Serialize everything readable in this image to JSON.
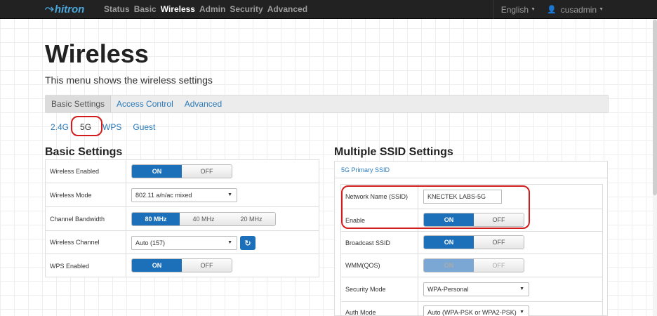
{
  "navbar": {
    "brand": "hitron",
    "links": [
      "Status",
      "Basic",
      "Wireless",
      "Admin",
      "Security",
      "Advanced"
    ],
    "active_link": "Wireless",
    "language": "English",
    "user": "cusadmin"
  },
  "page": {
    "title": "Wireless",
    "description": "This menu shows the wireless settings"
  },
  "tabs": [
    "Basic Settings",
    "Access Control",
    "Advanced"
  ],
  "active_tab": "Basic Settings",
  "subtabs": [
    "2.4G",
    "5G",
    "WPS",
    "Guest"
  ],
  "active_subtab": "5G",
  "basic_settings": {
    "title": "Basic Settings",
    "wireless_enabled": {
      "label": "Wireless Enabled",
      "on": "ON",
      "off": "OFF",
      "value": "ON"
    },
    "wireless_mode": {
      "label": "Wireless Mode",
      "value": "802.11 a/n/ac mixed"
    },
    "channel_bandwidth": {
      "label": "Channel Bandwidth",
      "options": [
        "80 MHz",
        "40 MHz",
        "20 MHz"
      ],
      "value": "80 MHz"
    },
    "wireless_channel": {
      "label": "Wireless Channel",
      "value": "Auto (157)"
    },
    "wps_enabled": {
      "label": "WPS Enabled",
      "on": "ON",
      "off": "OFF",
      "value": "ON"
    }
  },
  "multiple_ssid": {
    "title": "Multiple SSID Settings",
    "panel_heading": "5G Primary SSID",
    "network_name": {
      "label": "Network Name (SSID)",
      "value": "KNECTEK LABS-5G"
    },
    "enable": {
      "label": "Enable",
      "on": "ON",
      "off": "OFF",
      "value": "ON"
    },
    "broadcast_ssid": {
      "label": "Broadcast SSID",
      "on": "ON",
      "off": "OFF",
      "value": "ON"
    },
    "wmm_qos": {
      "label": "WMM(QOS)",
      "on": "ON",
      "off": "OFF",
      "value": "ON",
      "disabled": true
    },
    "security_mode": {
      "label": "Security Mode",
      "value": "WPA-Personal"
    },
    "auth_mode": {
      "label": "Auth Mode",
      "value": "Auto (WPA-PSK or WPA2-PSK)"
    }
  },
  "colors": {
    "accent": "#1c6fb9",
    "link": "#2a7ab9",
    "navbar_bg": "#222222",
    "highlight": "#d21b1b"
  },
  "icons": {
    "brand": "hitron-swirl-icon",
    "user": "user-icon",
    "dropdown": "caret-down-icon",
    "refresh": "refresh-icon"
  }
}
